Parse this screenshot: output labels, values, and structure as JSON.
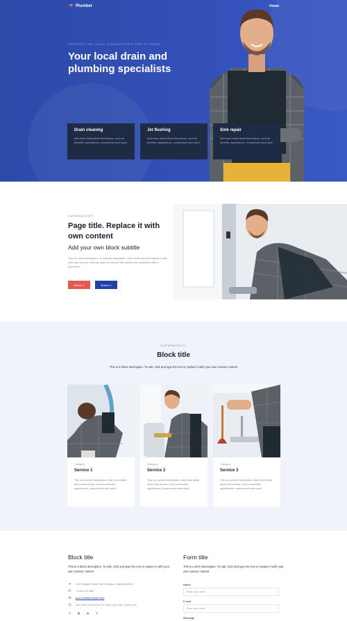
{
  "nav": {
    "brand": "Plumber",
    "link": "Home"
  },
  "hero": {
    "kicker": "SERVING THE LOCAL COMMUNITIES FOR 20 YEARS",
    "title": "Your local drain and plumbing specialists",
    "features": [
      {
        "title": "Drain cleaning",
        "text": "Add more detail about this feature, such as benefits, appearance, components and value."
      },
      {
        "title": "Jet flushing",
        "text": "Add more detail about this feature, such as benefits, appearance, components and value."
      },
      {
        "title": "Sink repair",
        "text": "Add more detail about this feature, such as benefits, appearance, components and value."
      }
    ]
  },
  "content": {
    "superscript": "SUPERSCRIPT",
    "title": "Page title. Replace it with own content",
    "subtitle": "Add your own block subtitle",
    "description": "This is a block description. To edit this description, click on the text and replace it with your own content. Use this space to convert site visitors into customers with a promotion.",
    "button1": "Button 1",
    "button2": "Button 2"
  },
  "services": {
    "superscript": "SUPERSCRIPT",
    "title": "Block title",
    "description": "This is a block description. To edit, click and type the text or replace it with your own custom content",
    "cards": [
      {
        "category": "Category",
        "title": "Service 1",
        "text": "This is a service description. Add more detail about this service, such as benefits, appearance, components and value."
      },
      {
        "category": "Category",
        "title": "Service 2",
        "text": "This is a service description. Add more detail about this service, such as benefits, appearance, components and value."
      },
      {
        "category": "Category",
        "title": "Service 3",
        "text": "This is a service description. Add more detail about this service, such as benefits, appearance, components and value."
      }
    ]
  },
  "contact": {
    "title": "Block title",
    "description": "This is a block description. To edit, click and type the text or replace it with your own custom content",
    "address": "153 Template Street San Francisco, California 94117",
    "phone": "+1 800 123 4567",
    "email": "your.email@example.com",
    "hours": "Sun-Thurs 9 am-6 pm, Fri 9 am-4 pm, Sat, 10 am-4 pm",
    "socials": [
      "f",
      "◎",
      "in",
      "t"
    ]
  },
  "form": {
    "title": "Form title",
    "description": "This is a form description. To edit, click and type the text or replace it with your own custom content",
    "name_label": "Name",
    "name_placeholder": "Enter your name",
    "email_label": "E-mail",
    "email_placeholder": "Enter your email",
    "message_label": "Message"
  },
  "colors": {
    "hero_blue": "#3350b8",
    "dark_card": "#1f2a44",
    "accent_red": "#e45a52",
    "accent_blue": "#2342a6",
    "section_bg": "#f0f4fa"
  }
}
